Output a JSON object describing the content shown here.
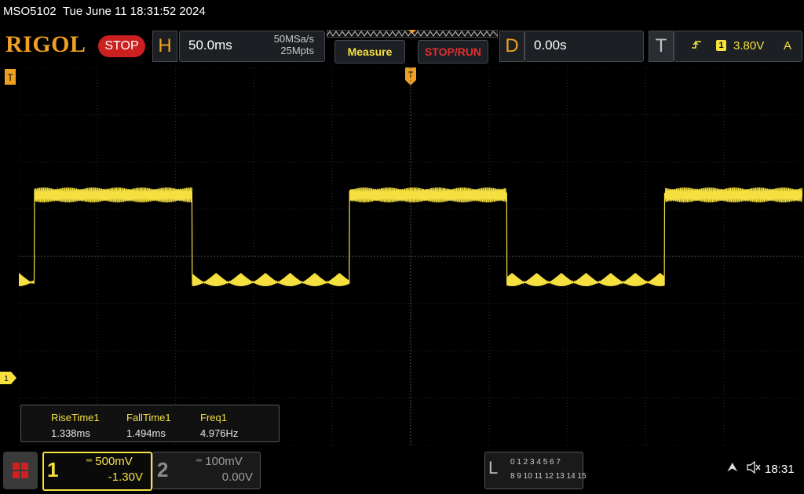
{
  "header": {
    "model": "MSO5102",
    "datetime": "Tue June 11 18:31:52 2024"
  },
  "toolbar": {
    "brand": "RIGOL",
    "run_state": "STOP",
    "horizontal": {
      "letter": "H",
      "timebase": "50.0ms",
      "sample_rate": "50MSa/s",
      "memory_depth": "25Mpts"
    },
    "measure_label": "Measure",
    "stoprun_label": "STOP/RUN",
    "delay": {
      "letter": "D",
      "value": "0.00s"
    },
    "trigger": {
      "letter": "T",
      "edge_icon": "rising-edge-icon",
      "source": "1",
      "level": "3.80V",
      "mode": "A"
    }
  },
  "markers": {
    "trigger_position": "T",
    "trigger_level": "T",
    "ch1_ground": "1"
  },
  "measurements": [
    {
      "name": "RiseTime1",
      "value": "1.338ms"
    },
    {
      "name": "FallTime1",
      "value": "1.494ms"
    },
    {
      "name": "Freq1",
      "value": "4.976Hz"
    }
  ],
  "channels": {
    "ch1": {
      "number": "1",
      "scale": "500mV",
      "offset": "-1.30V",
      "color": "#f5e040",
      "active": true
    },
    "ch2": {
      "number": "2",
      "scale": "100mV",
      "offset": "0.00V",
      "color": "#9a9a9a",
      "active": false
    }
  },
  "logic": {
    "letter": "L",
    "row1": "0 1 2 3  4 5 6 7",
    "row2": "8 9 10 11 12 13 14 15"
  },
  "status": {
    "time": "18:31"
  },
  "colors": {
    "accent": "#f0a020",
    "ch1": "#f5e040",
    "stop": "#cc2020",
    "grid": "#3a3a3a"
  },
  "waveform": {
    "channel": "1",
    "frequency_hz": 4.976,
    "timebase_ms_per_div": 50,
    "high_level_div": -1.3,
    "low_level_div": 0.35,
    "ripple_div": 0.35
  }
}
